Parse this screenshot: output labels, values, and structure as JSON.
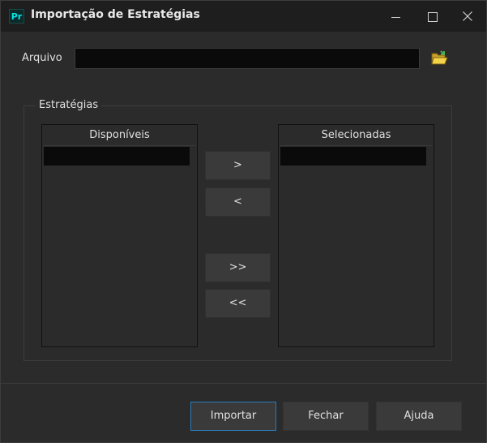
{
  "window": {
    "app_icon_text": "Pr",
    "title": "Importação de Estratégias"
  },
  "file": {
    "label": "Arquivo",
    "value": "",
    "icon": "folder-open-icon"
  },
  "strategies": {
    "group_label": "Estratégias",
    "available": {
      "header": "Disponíveis",
      "items": []
    },
    "selected": {
      "header": "Selecionadas",
      "items": []
    },
    "buttons": {
      "add": ">",
      "remove": "<",
      "add_all": ">>",
      "remove_all": "<<"
    }
  },
  "footer": {
    "import": "Importar",
    "close": "Fechar",
    "help": "Ajuda"
  },
  "colors": {
    "background": "#2b2b2b",
    "titlebar": "#1e1e1e",
    "accent": "#2b7bb9",
    "input_bg": "#0a0a0a"
  }
}
